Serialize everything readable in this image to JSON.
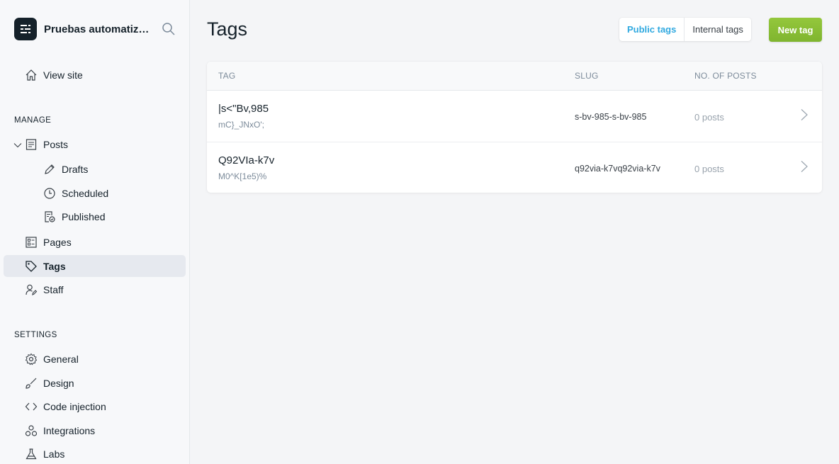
{
  "brand": {
    "name": "Pruebas automatizadas",
    "logo_icon": "ghost-logo-icon"
  },
  "sidebar": {
    "view_site": "View site",
    "manage_title": "MANAGE",
    "manage": [
      {
        "label": "Posts",
        "icon": "posts-icon"
      },
      {
        "label": "Drafts",
        "icon": "pencil-icon"
      },
      {
        "label": "Scheduled",
        "icon": "clock-icon"
      },
      {
        "label": "Published",
        "icon": "published-icon"
      },
      {
        "label": "Pages",
        "icon": "pages-icon"
      },
      {
        "label": "Tags",
        "icon": "tag-icon"
      },
      {
        "label": "Staff",
        "icon": "staff-icon"
      }
    ],
    "settings_title": "SETTINGS",
    "settings": [
      {
        "label": "General",
        "icon": "gear-icon"
      },
      {
        "label": "Design",
        "icon": "brush-icon"
      },
      {
        "label": "Code injection",
        "icon": "code-icon"
      },
      {
        "label": "Integrations",
        "icon": "integrations-icon"
      },
      {
        "label": "Labs",
        "icon": "flask-icon"
      }
    ]
  },
  "main": {
    "title": "Tags",
    "tabs": [
      "Public tags",
      "Internal tags"
    ],
    "active_tab": "Public tags",
    "new_button": "New tag",
    "table": {
      "headers": [
        "TAG",
        "SLUG",
        "NO. OF POSTS"
      ],
      "rows": [
        {
          "name": "|s<\"Bv,985",
          "description": "mC}_JNxO';",
          "slug": "s-bv-985-s-bv-985",
          "posts": "0 posts"
        },
        {
          "name": "Q92VIa-k7v",
          "description": "M0^K[1e5)%",
          "slug": "q92via-k7vq92via-k7v",
          "posts": "0 posts"
        }
      ]
    }
  },
  "colors": {
    "accent": "#30a9e0",
    "primary_button": "#8bc34a",
    "active_nav_bg": "#e6e9ef"
  }
}
